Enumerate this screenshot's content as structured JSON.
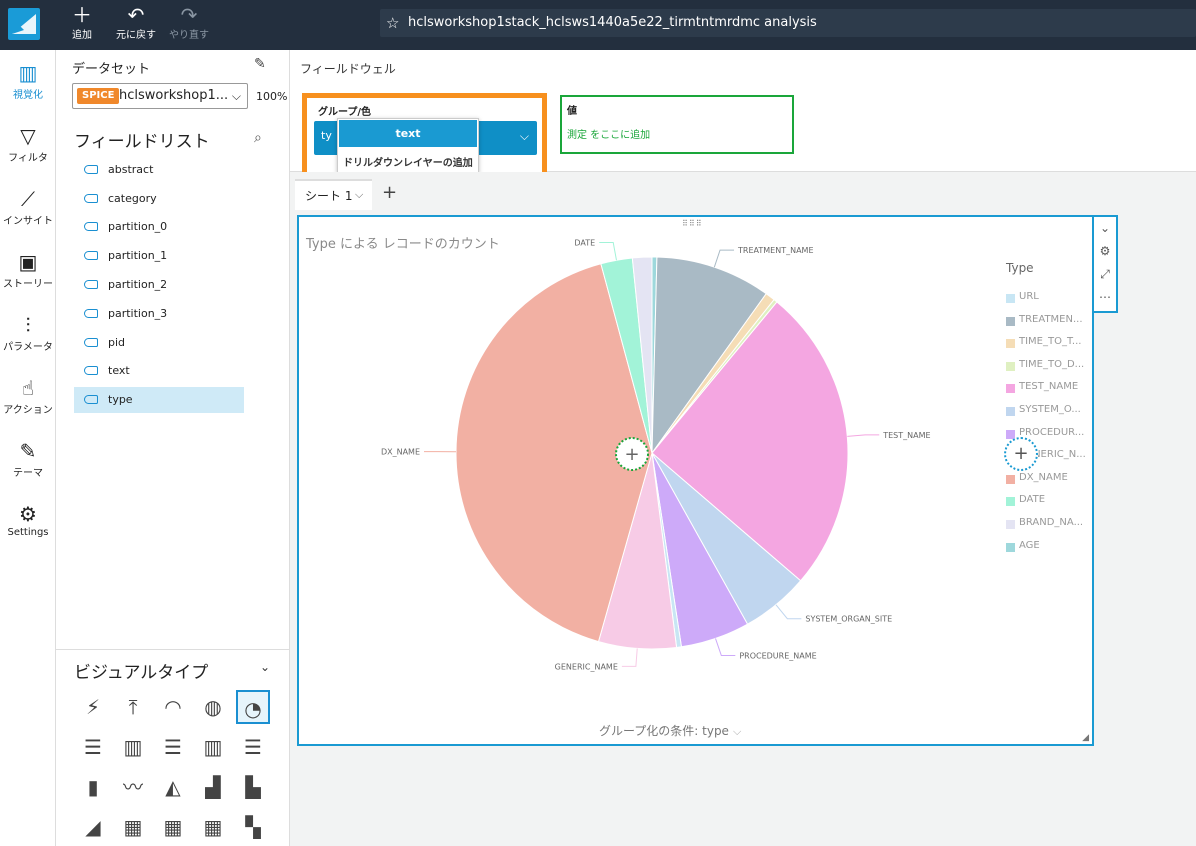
{
  "topbar": {
    "buttons": [
      {
        "icon": "plus-icon",
        "glyph": "＋",
        "label": "追加"
      },
      {
        "icon": "undo-icon",
        "glyph": "↶",
        "label": "元に戻す"
      },
      {
        "icon": "redo-icon",
        "glyph": "↷",
        "label": "やり直す"
      }
    ],
    "title": "hclsworkshop1stack_hclsws1440a5e22_tirmtntmrdmc analysis"
  },
  "nav": [
    {
      "name": "visualize",
      "glyph": "▥",
      "label": "視覚化"
    },
    {
      "name": "filter",
      "glyph": "▽",
      "label": "フィルタ"
    },
    {
      "name": "insights",
      "glyph": "⟋",
      "label": "インサイト"
    },
    {
      "name": "stories",
      "glyph": "▣",
      "label": "ストーリー"
    },
    {
      "name": "parameters",
      "glyph": "⫶",
      "label": "パラメータ"
    },
    {
      "name": "actions",
      "glyph": "☝",
      "label": "アクション"
    },
    {
      "name": "themes",
      "glyph": "✎",
      "label": "テーマ"
    },
    {
      "name": "settings",
      "glyph": "⚙",
      "label": "Settings"
    }
  ],
  "dataset": {
    "title": "データセット",
    "badge": "SPICE",
    "name": "hclsworkshop1...",
    "percent": "100%"
  },
  "field_list": {
    "title": "フィールドリスト",
    "fields": [
      "abstract",
      "category",
      "partition_0",
      "partition_1",
      "partition_2",
      "partition_3",
      "pid",
      "text",
      "type"
    ],
    "selected": "type"
  },
  "visual_types": {
    "title": "ビジュアルタイプ",
    "icons": [
      {
        "name": "autograph-icon",
        "glyph": "⚡"
      },
      {
        "name": "kpi-icon",
        "glyph": "⤒"
      },
      {
        "name": "gauge-icon",
        "glyph": "◠"
      },
      {
        "name": "donut-icon",
        "glyph": "◍"
      },
      {
        "name": "pie-icon",
        "glyph": "◔"
      },
      {
        "name": "hbar-icon",
        "glyph": "☰"
      },
      {
        "name": "vbar-icon",
        "glyph": "▥"
      },
      {
        "name": "hbar-stacked-icon",
        "glyph": "☰"
      },
      {
        "name": "vbar-stacked-icon",
        "glyph": "▥"
      },
      {
        "name": "hbar-100-icon",
        "glyph": "☰"
      },
      {
        "name": "vbar-100-icon",
        "glyph": "▮"
      },
      {
        "name": "line-icon",
        "glyph": "〰"
      },
      {
        "name": "area-icon",
        "glyph": "◭"
      },
      {
        "name": "combo-bar-line-icon",
        "glyph": "▟"
      },
      {
        "name": "combo-clustered-icon",
        "glyph": "▙"
      },
      {
        "name": "area-line-icon",
        "glyph": "◢"
      },
      {
        "name": "pivot-icon",
        "glyph": "▦"
      },
      {
        "name": "table-icon",
        "glyph": "▦"
      },
      {
        "name": "heatmap-icon",
        "glyph": "▦"
      },
      {
        "name": "treemap-icon",
        "glyph": "▚"
      }
    ]
  },
  "field_wells": {
    "label": "フィールドウェル",
    "group_title": "グループ/色",
    "group_field_short": "ty",
    "drill_field": "text",
    "drill_add": "ドリルダウンレイヤーの追加",
    "value_title": "値",
    "value_hint": "測定 をここに追加"
  },
  "sheet": {
    "tab": "シート 1",
    "add": "+"
  },
  "visual": {
    "title": "Type による レコードのカウント",
    "groupby": "グループ化の条件: type"
  },
  "chart_data": {
    "type": "pie",
    "title": "Type による レコードのカウント",
    "legend_title": "Type",
    "legend_position": "right",
    "slices": [
      {
        "label": "AGE",
        "value": 0.4,
        "color": "#9ed8dc",
        "show": false
      },
      {
        "label": "TREATMENT_NAME",
        "value": 9.5,
        "color": "#a9bac5",
        "show": true
      },
      {
        "label": "TIME_TO_TREATMENT",
        "value": 0.8,
        "color": "#f5ddb6",
        "show": false
      },
      {
        "label": "TIME_TO_DIAGNOSIS",
        "value": 0.3,
        "color": "#dff0c1",
        "show": false
      },
      {
        "label": "TEST_NAME",
        "value": 25.3,
        "color": "#f4a6e1",
        "show": true
      },
      {
        "label": "SYSTEM_ORGAN_SITE",
        "value": 5.6,
        "color": "#c0d6ef",
        "show": true
      },
      {
        "label": "PROCEDURE_NAME",
        "value": 5.7,
        "color": "#cdaaf9",
        "show": true
      },
      {
        "label": "URL",
        "value": 0.4,
        "color": "#c8e6f4",
        "show": false
      },
      {
        "label": "GENERIC_NAME",
        "value": 6.4,
        "color": "#f7cbe6",
        "show": true
      },
      {
        "label": "DX_NAME",
        "value": 41.4,
        "color": "#f2b0a3",
        "show": true
      },
      {
        "label": "DATE",
        "value": 2.6,
        "color": "#a2f3d8",
        "show": true
      },
      {
        "label": "BRAND_NAME",
        "value": 1.6,
        "color": "#e4e4f3",
        "show": false
      }
    ],
    "legend": [
      {
        "label": "URL",
        "color": "#c8e6f4"
      },
      {
        "label": "TREATMEN...",
        "color": "#a9bac5"
      },
      {
        "label": "TIME_TO_T...",
        "color": "#f5ddb6"
      },
      {
        "label": "TIME_TO_D...",
        "color": "#dff0c1"
      },
      {
        "label": "TEST_NAME",
        "color": "#f4a6e1"
      },
      {
        "label": "SYSTEM_O...",
        "color": "#c0d6ef"
      },
      {
        "label": "PROCEDUR...",
        "color": "#cdaaf9"
      },
      {
        "label": "GENERIC_N...",
        "color": "#f7cbe6"
      },
      {
        "label": "DX_NAME",
        "color": "#f2b0a3"
      },
      {
        "label": "DATE",
        "color": "#a2f3d8"
      },
      {
        "label": "BRAND_NA...",
        "color": "#e4e4f3"
      },
      {
        "label": "AGE",
        "color": "#9ed8dc"
      }
    ]
  }
}
